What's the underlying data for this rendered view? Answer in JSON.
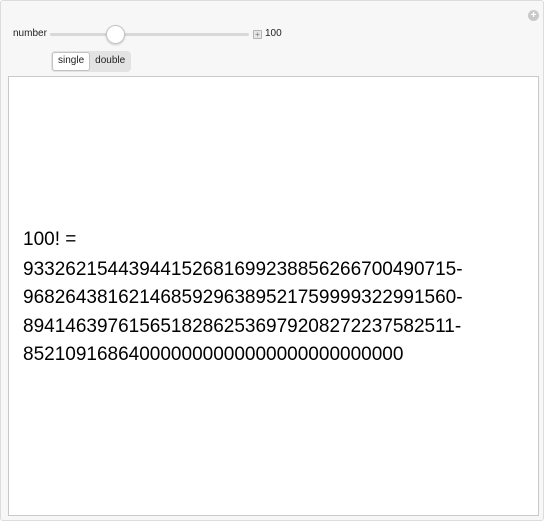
{
  "controls": {
    "number_label": "number",
    "number_value": "100",
    "slider_fraction": 0.33,
    "plus_symbol": "+",
    "corner_symbol": "+"
  },
  "modes": {
    "options": [
      "single",
      "double"
    ],
    "selected": "single"
  },
  "output": {
    "heading": "100! =",
    "lines": [
      "933262154439441526816992388562667004907 15-",
      "968264381621468592963895217599993229915 60-",
      "894146397615651828625369792082722375825 11-",
      "852109168640000000000000000000000000"
    ]
  }
}
